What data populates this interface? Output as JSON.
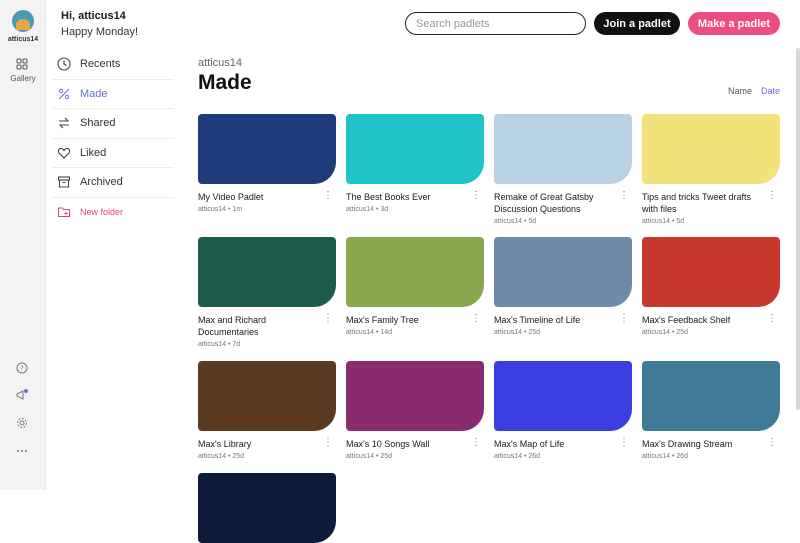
{
  "rail": {
    "username": "atticus14",
    "gallery_label": "Gallery",
    "icons": [
      "help-icon",
      "announcement-icon",
      "settings-icon",
      "more-icon"
    ]
  },
  "greeting": {
    "hi": "Hi, atticus14",
    "sub": "Happy Monday!"
  },
  "search": {
    "placeholder": "Search padlets"
  },
  "buttons": {
    "join": "Join a padlet",
    "make": "Make a padlet"
  },
  "nav": {
    "items": [
      {
        "label": "Recents",
        "icon": "clock-icon"
      },
      {
        "label": "Made",
        "icon": "sparkle-icon",
        "active": true
      },
      {
        "label": "Shared",
        "icon": "share-icon"
      },
      {
        "label": "Liked",
        "icon": "heart-icon"
      },
      {
        "label": "Archived",
        "icon": "archive-icon"
      }
    ],
    "new_folder": "New folder"
  },
  "main": {
    "breadcrumb": "atticus14",
    "title": "Made",
    "sort": {
      "name": "Name",
      "date": "Date"
    }
  },
  "cards": [
    {
      "title": "My Video Padlet",
      "meta": "atticus14 • 1m",
      "bg": "#1e3a7a"
    },
    {
      "title": "The Best Books Ever",
      "meta": "atticus14 • 3d",
      "bg": "#1fc4c8"
    },
    {
      "title": "Remake of Great Gatsby Discussion Questions",
      "meta": "atticus14 • 5d",
      "bg": "#b9d2e3"
    },
    {
      "title": "Tips and tricks Tweet drafts with files",
      "meta": "atticus14 • 5d",
      "bg": "#f2e27a"
    },
    {
      "title": "Max and Richard Documentaries",
      "meta": "atticus14 • 7d",
      "bg": "#1f5b4a"
    },
    {
      "title": "Max's Family Tree",
      "meta": "atticus14 • 14d",
      "bg": "#8aa74c"
    },
    {
      "title": "Max's Timeline of Life",
      "meta": "atticus14 • 25d",
      "bg": "#6e8aa6"
    },
    {
      "title": "Max's Feedback Shelf",
      "meta": "atticus14 • 25d",
      "bg": "#c7392f"
    },
    {
      "title": "Max's Library",
      "meta": "atticus14 • 25d",
      "bg": "#5a3b22"
    },
    {
      "title": "Max's 10 Songs Wall",
      "meta": "atticus14 • 25d",
      "bg": "#8a2b6e"
    },
    {
      "title": "Max's Map of Life",
      "meta": "atticus14 • 26d",
      "bg": "#3b3ee0"
    },
    {
      "title": "Max's Drawing Stream",
      "meta": "atticus14 • 26d",
      "bg": "#3f7a97"
    },
    {
      "title": "",
      "meta": "",
      "bg": "#0d1a3a"
    }
  ]
}
